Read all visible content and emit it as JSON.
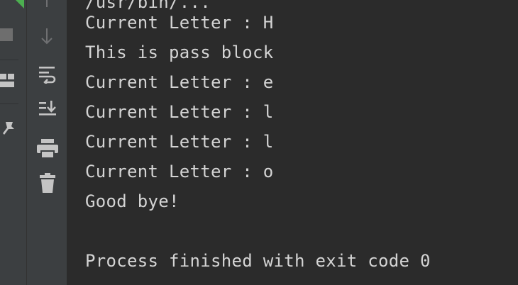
{
  "toolbar": {
    "icons": [
      "scroll-up-icon",
      "scroll-down-icon",
      "soft-wrap-icon",
      "scroll-to-end-icon",
      "print-icon",
      "trash-icon"
    ]
  },
  "left_strip": {
    "icons": [
      "run-icon",
      "stop-icon",
      "layout-icon",
      "pin-icon"
    ]
  },
  "console": {
    "lines": [
      "/usr/bin/...",
      "Current Letter : H",
      "This is pass block",
      "Current Letter : e",
      "Current Letter : l",
      "Current Letter : l",
      "Current Letter : o",
      "Good bye!",
      "",
      "Process finished with exit code 0"
    ]
  },
  "colors": {
    "console_bg": "#2b2b2b",
    "panel_bg": "#3c3f41",
    "text": "#d4d4d4",
    "icon": "#a9b7c6",
    "run_green": "#59a869"
  }
}
